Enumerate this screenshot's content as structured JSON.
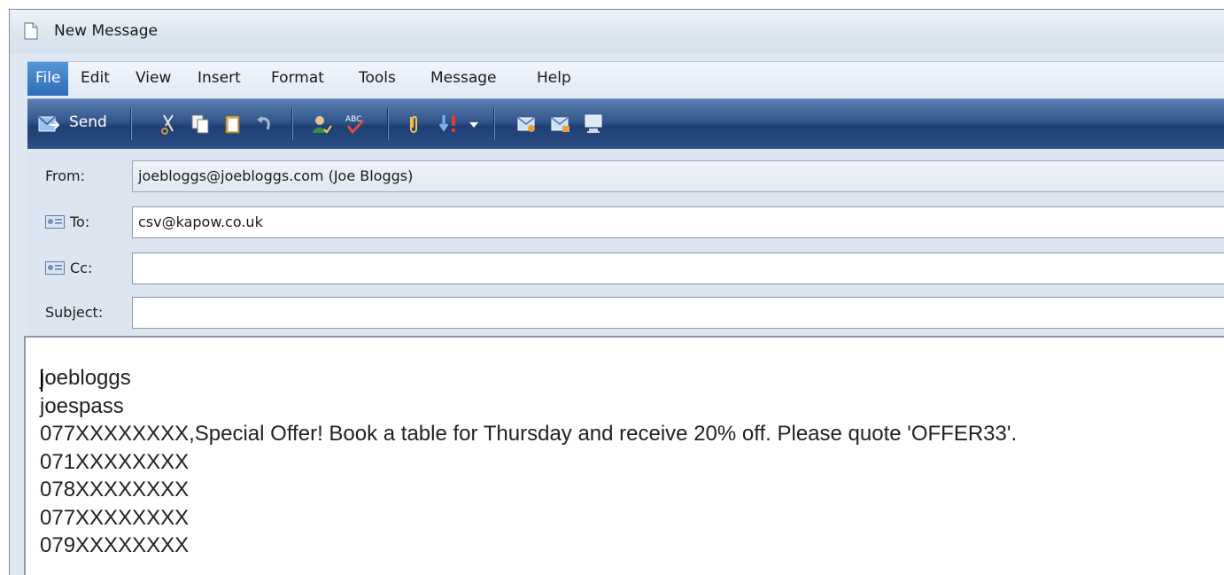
{
  "window": {
    "title": "New Message"
  },
  "menu": {
    "items": [
      "File",
      "Edit",
      "View",
      "Insert",
      "Format",
      "Tools",
      "Message",
      "Help"
    ],
    "active": "File"
  },
  "toolbar": {
    "send_label": "Send",
    "buttons": [
      "cut-icon",
      "copy-icon",
      "paste-icon",
      "undo-icon",
      "check-names-icon",
      "spelling-icon",
      "attach-icon",
      "priority-icon",
      "priority-dropdown-icon",
      "sign-icon",
      "encrypt-icon",
      "offline-icon"
    ]
  },
  "fields": {
    "from_label": "From:",
    "from_value": "joebloggs@joebloggs.com    (Joe Bloggs)",
    "to_label": "To:",
    "to_value": "csv@kapow.co.uk",
    "cc_label": "Cc:",
    "cc_value": "",
    "subject_label": "Subject:",
    "subject_value": ""
  },
  "body": {
    "lines": [
      "joebloggs",
      "joespass",
      "077XXXXXXXX,Special Offer! Book a table for Thursday and receive 20% off. Please quote 'OFFER33'.",
      "071XXXXXXXX",
      "078XXXXXXXX",
      "077XXXXXXXX",
      "079XXXXXXXX"
    ]
  }
}
